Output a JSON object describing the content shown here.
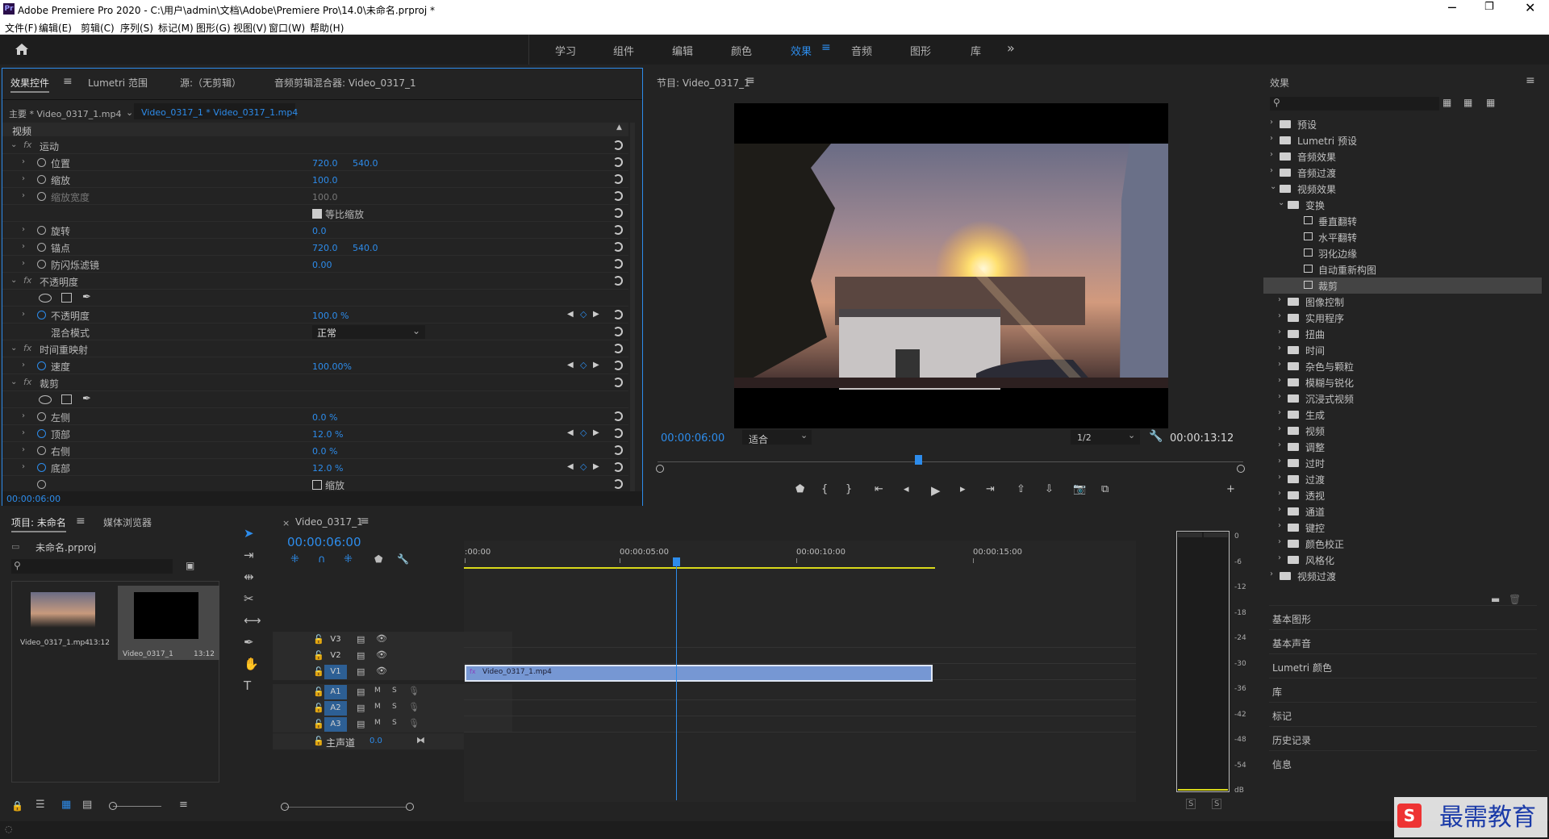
{
  "app": {
    "title": "Adobe Premiere Pro 2020 - C:\\用户\\admin\\文档\\Adobe\\Premiere Pro\\14.0\\未命名.prproj *"
  },
  "menu": [
    "文件(F)",
    "编辑(E)",
    "剪辑(C)",
    "序列(S)",
    "标记(M)",
    "图形(G)",
    "视图(V)",
    "窗口(W)",
    "帮助(H)"
  ],
  "workspaces": [
    "学习",
    "组件",
    "编辑",
    "颜色",
    "效果",
    "音频",
    "图形",
    "库"
  ],
  "active_workspace": "效果",
  "effect_controls": {
    "tabs": [
      "效果控件",
      "Lumetri 范围",
      "源:（无剪辑）",
      "音频剪辑混合器: Video_0317_1"
    ],
    "master_clip": "主要 * Video_0317_1.mp4",
    "seq_clip": "Video_0317_1 * Video_0317_1.mp4",
    "section": "视频",
    "rows": [
      {
        "label": "运动",
        "fx": true
      },
      {
        "label": "位置",
        "v1": "720.0",
        "v2": "540.0"
      },
      {
        "label": "缩放",
        "v1": "100.0"
      },
      {
        "label": "缩放宽度",
        "v1": "100.0",
        "dim": true
      },
      {
        "label": "",
        "check": "等比缩放"
      },
      {
        "label": "旋转",
        "v1": "0.0"
      },
      {
        "label": "锚点",
        "v1": "720.0",
        "v2": "540.0"
      },
      {
        "label": "防闪烁滤镜",
        "v1": "0.00"
      },
      {
        "label": "不透明度",
        "fx": true
      },
      {
        "label": "",
        "shapes": true
      },
      {
        "label": "不透明度",
        "v1": "100.0 %",
        "kf": true
      },
      {
        "label": "混合模式",
        "select": "正常"
      },
      {
        "label": "时间重映射",
        "fx": true
      },
      {
        "label": "速度",
        "v1": "100.00%",
        "kf": true
      },
      {
        "label": "裁剪",
        "fx": true
      },
      {
        "label": "",
        "shapes": true
      },
      {
        "label": "左侧",
        "v1": "0.0 %"
      },
      {
        "label": "顶部",
        "v1": "12.0 %",
        "kf": true
      },
      {
        "label": "右侧",
        "v1": "0.0 %"
      },
      {
        "label": "底部",
        "v1": "12.0 %",
        "kf": true
      },
      {
        "label": "",
        "check": "缩放"
      }
    ],
    "timecode": "00:00:06:00"
  },
  "program": {
    "title": "节目: Video_0317_1",
    "timecode": "00:00:06:00",
    "fit": "适合",
    "quality": "1/2",
    "duration": "00:00:13:12"
  },
  "project": {
    "tabs": [
      "项目: 未命名",
      "媒体浏览器"
    ],
    "file": "未命名.prproj",
    "items": [
      {
        "name": "Video_0317_1.mp4",
        "dur": "13:12"
      },
      {
        "name": "Video_0317_1",
        "dur": "13:12"
      }
    ]
  },
  "timeline": {
    "tab": "Video_0317_1",
    "timecode": "00:00:06:00",
    "ruler": [
      ":00:00",
      "00:00:05:00",
      "00:00:10:00",
      "00:00:15:00"
    ],
    "video_tracks": [
      "V3",
      "V2",
      "V1"
    ],
    "audio_tracks": [
      "A1",
      "A2",
      "A3"
    ],
    "master": "主声道",
    "master_val": "0.0",
    "clip": "Video_0317_1.mp4",
    "playhead_fraction": 0.444
  },
  "meter": {
    "scale": [
      "0",
      "-6",
      "-12",
      "-18",
      "-24",
      "-30",
      "-36",
      "-42",
      "-48",
      "-54",
      "dB"
    ],
    "solo": [
      "S",
      "S"
    ]
  },
  "effects": {
    "title": "效果",
    "tree": [
      {
        "label": "预设",
        "level": 0
      },
      {
        "label": "Lumetri 预设",
        "level": 0
      },
      {
        "label": "音频效果",
        "level": 0
      },
      {
        "label": "音频过渡",
        "level": 0
      },
      {
        "label": "视频效果",
        "level": 0,
        "open": true
      },
      {
        "label": "变换",
        "level": 1,
        "open": true
      },
      {
        "label": "垂直翻转",
        "level": 2
      },
      {
        "label": "水平翻转",
        "level": 2
      },
      {
        "label": "羽化边缘",
        "level": 2
      },
      {
        "label": "自动重新构图",
        "level": 2
      },
      {
        "label": "裁剪",
        "level": 2,
        "selected": true
      },
      {
        "label": "图像控制",
        "level": 1
      },
      {
        "label": "实用程序",
        "level": 1
      },
      {
        "label": "扭曲",
        "level": 1
      },
      {
        "label": "时间",
        "level": 1
      },
      {
        "label": "杂色与颗粒",
        "level": 1
      },
      {
        "label": "模糊与锐化",
        "level": 1
      },
      {
        "label": "沉浸式视频",
        "level": 1
      },
      {
        "label": "生成",
        "level": 1
      },
      {
        "label": "视频",
        "level": 1
      },
      {
        "label": "调整",
        "level": 1
      },
      {
        "label": "过时",
        "level": 1
      },
      {
        "label": "过渡",
        "level": 1
      },
      {
        "label": "透视",
        "level": 1
      },
      {
        "label": "通道",
        "level": 1
      },
      {
        "label": "键控",
        "level": 1
      },
      {
        "label": "颜色校正",
        "level": 1
      },
      {
        "label": "风格化",
        "level": 1
      },
      {
        "label": "视频过渡",
        "level": 0
      }
    ],
    "side_panels": [
      "基本图形",
      "基本声音",
      "Lumetri 颜色",
      "库",
      "标记",
      "历史记录",
      "信息"
    ]
  },
  "watermark": "最需教育"
}
